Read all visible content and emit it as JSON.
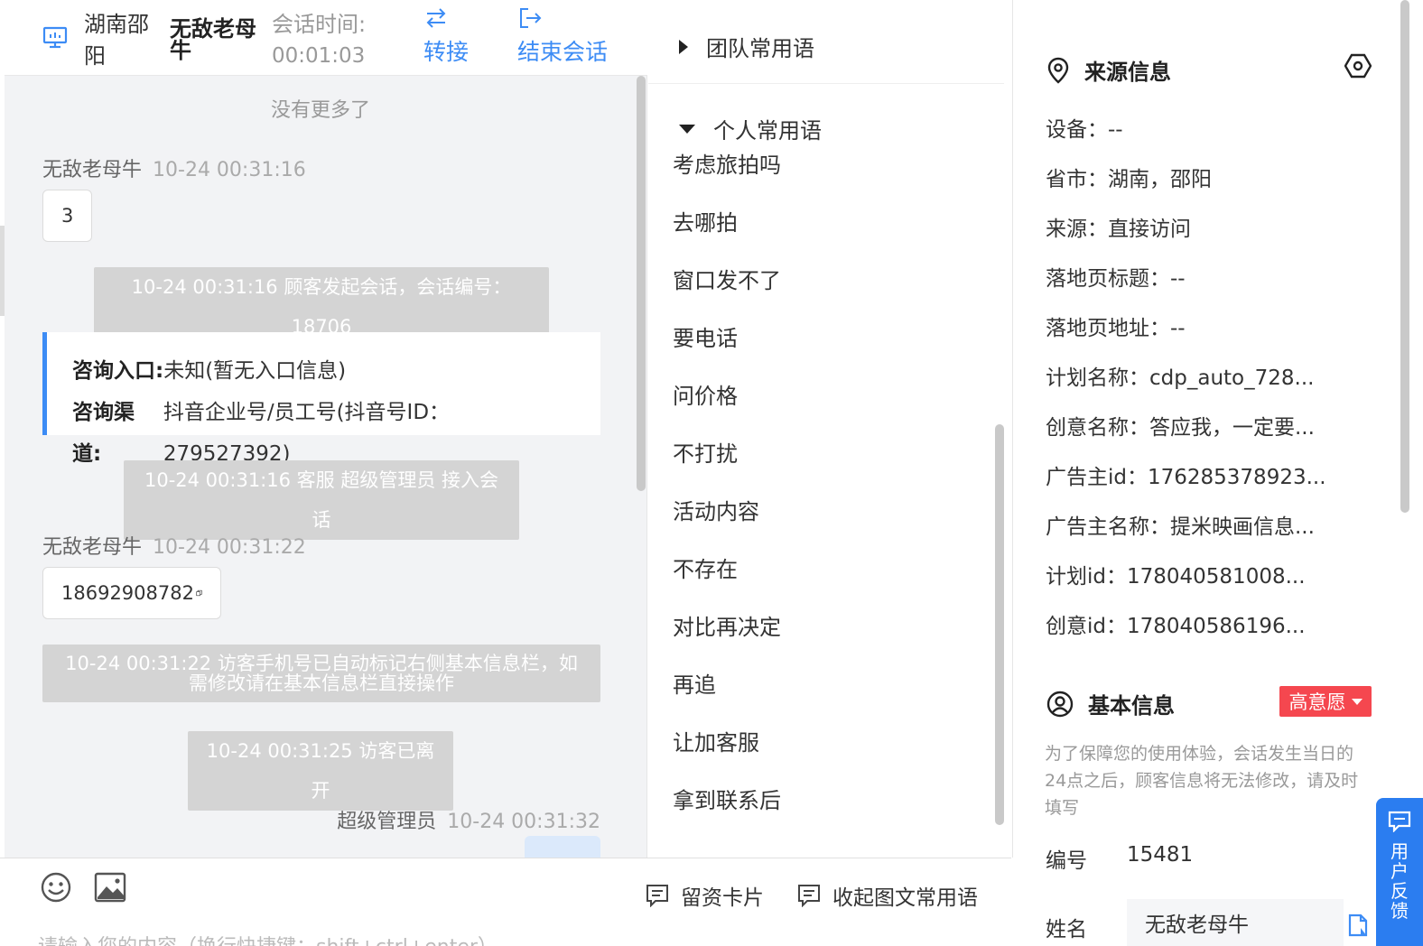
{
  "header": {
    "location": "湖南邵阳",
    "visitor_name": "无敌老母牛",
    "session_time_label": "会话时间:",
    "session_time_value": "00:01:03",
    "transfer_label": "转接",
    "end_session_label": "结束会话"
  },
  "chat": {
    "no_more": "没有更多了",
    "messages": [
      {
        "sender": "无敌老母牛",
        "time": "10-24 00:31:16",
        "text": "3"
      },
      {
        "sender": "无敌老母牛",
        "time": "10-24 00:31:22",
        "text": "18692908782"
      }
    ],
    "system": [
      "10-24 00:31:16 顾客发起会话，会话编号：18706",
      "10-24 00:31:16 客服 超级管理员 接入会话",
      "10-24 00:31:22 访客手机号已自动标记右侧基本信息栏，如需修改请在基本信息栏直接操作",
      "10-24 00:31:25 访客已离开"
    ],
    "card": {
      "entry_label": "咨询入口:",
      "entry_value": "未知(暂无入口信息)",
      "channel_label": "咨询渠道:",
      "channel_value": "抖音企业号/员工号(抖音号ID：279527392)"
    },
    "agent_sender": "超级管理员",
    "agent_time": "10-24 00:31:32"
  },
  "composer": {
    "lead_card_label": "留资卡片",
    "collapse_label": "收起图文常用语",
    "placeholder": "请输入您的内容（换行快捷键：shift+ctrl+enter）"
  },
  "phrases": {
    "team_group": "团队常用语",
    "personal_group": "个人常用语",
    "items": [
      "考虑旅拍吗",
      "去哪拍",
      "窗口发不了",
      "要电话",
      "问价格",
      "不打扰",
      "活动内容",
      "不存在",
      "对比再决定",
      "再追",
      "让加客服",
      "拿到联系后"
    ]
  },
  "source_info": {
    "title": "来源信息",
    "rows": [
      "设备：--",
      "省市：湖南，邵阳",
      "来源：直接访问",
      "落地页标题：--",
      "落地页地址：--",
      "计划名称：cdp_auto_728...",
      "创意名称：答应我，一定要...",
      "广告主id：176285378923...",
      "广告主名称：提米映画信息...",
      "计划id：178040581008...",
      "创意id：178040586196..."
    ]
  },
  "basic_info": {
    "title": "基本信息",
    "intent_badge": "高意愿",
    "tip": "为了保障您的使用体验，会话发生当日的24点之后，顾客信息将无法修改，请及时填写",
    "id_label": "编号",
    "id_value": "15481",
    "name_label": "姓名",
    "name_value": "无敌老母牛"
  },
  "feedback": {
    "label": "用户反馈"
  },
  "colors": {
    "accent": "#3d8cf5",
    "badge": "#f5474f",
    "feedback": "#2b7df0"
  }
}
